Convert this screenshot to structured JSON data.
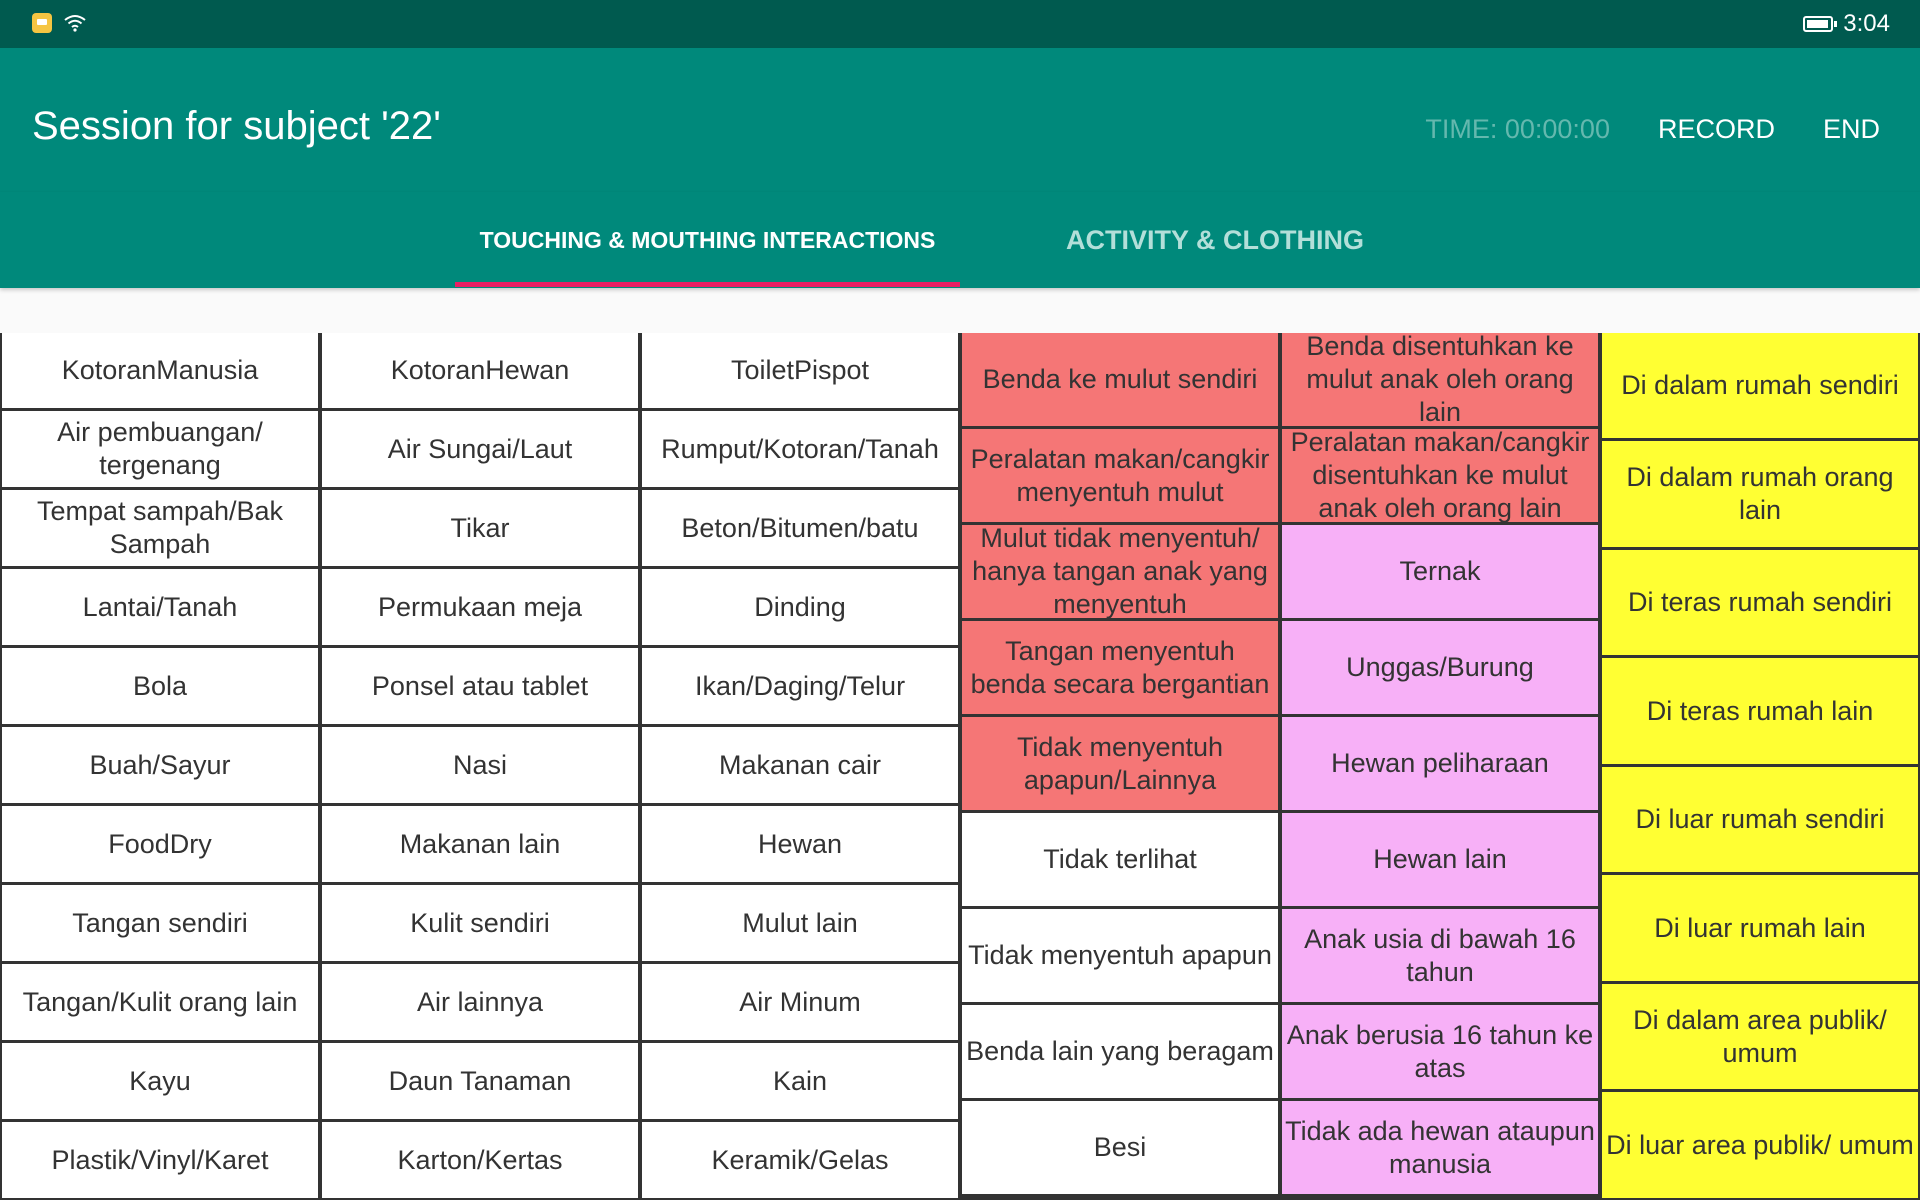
{
  "status_bar": {
    "time": "3:04",
    "icons": [
      "sim-icon",
      "wifi-icon",
      "battery-icon"
    ]
  },
  "app_bar": {
    "title": "Session for subject '22'",
    "timer": "TIME: 00:00:00",
    "record_label": "RECORD",
    "end_label": "END"
  },
  "tabs": [
    {
      "label": "TOUCHING & MOUTHING INTERACTIONS",
      "selected": true
    },
    {
      "label": "ACTIVITY & CLOTHING",
      "selected": false
    }
  ],
  "colors": {
    "primary": "#00897b",
    "primary_dark": "#005a4f",
    "accent": "#e91e63",
    "mouthing": "#f57676",
    "animals": "#f7b0f7",
    "location": "#ffff33"
  },
  "grid": {
    "col1": [
      "KotoranManusia",
      "Air pembuangan/ tergenang",
      "Tempat sampah/Bak Sampah",
      "Lantai/Tanah",
      "Bola",
      "Buah/Sayur",
      "FoodDry",
      "Tangan sendiri",
      "Tangan/Kulit orang lain",
      "Kayu",
      "Plastik/Vinyl/Karet"
    ],
    "col2": [
      "KotoranHewan",
      "Air Sungai/Laut",
      "Tikar",
      "Permukaan meja",
      "Ponsel atau tablet",
      "Nasi",
      "Makanan lain",
      "Kulit sendiri",
      "Air lainnya",
      "Daun Tanaman",
      "Karton/Kertas"
    ],
    "col3": [
      "ToiletPispot",
      "Rumput/Kotoran/Tanah",
      "Beton/Bitumen/batu",
      "Dinding",
      "Ikan/Daging/Telur",
      "Makanan cair",
      "Hewan",
      "Mulut lain",
      "Air Minum",
      "Kain",
      "Keramik/Gelas"
    ],
    "col4": [
      "Benda ke mulut sendiri",
      "Peralatan makan/cangkir menyentuh mulut",
      "Mulut tidak menyentuh/ hanya tangan anak yang menyentuh",
      "Tangan menyentuh benda secara bergantian",
      "Tidak menyentuh apapun/Lainnya",
      "Tidak terlihat",
      "Tidak menyentuh apapun",
      "Benda lain yang beragam",
      "Besi"
    ],
    "col5": [
      "Benda disentuhkan ke mulut anak oleh orang lain",
      "Peralatan makan/cangkir disentuhkan ke mulut anak oleh orang lain",
      "Ternak",
      "Unggas/Burung",
      "Hewan peliharaan",
      "Hewan lain",
      "Anak usia di bawah 16 tahun",
      "Anak berusia 16 tahun ke atas",
      "Tidak ada hewan ataupun manusia"
    ],
    "col6": [
      "Di dalam rumah sendiri",
      "Di dalam rumah orang lain",
      "Di teras rumah sendiri",
      "Di teras rumah lain",
      "Di luar rumah sendiri",
      "Di luar rumah lain",
      "Di dalam area publik/ umum",
      "Di luar area publik/ umum"
    ]
  }
}
